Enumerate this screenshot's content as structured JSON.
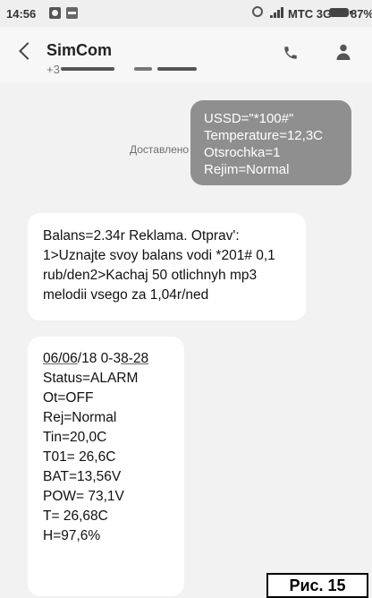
{
  "status_bar": {
    "time": "14:56",
    "carrier": "MTC 3G",
    "battery": "87%"
  },
  "header": {
    "contact_name": "SimCom",
    "contact_number_prefix": "+3"
  },
  "outgoing_message": {
    "status": "Доставлено",
    "lines": [
      "USSD=\"*100#\"",
      "Temperature=12,3C",
      "Otsrochka=1",
      "Rejim=Normal"
    ]
  },
  "incoming_1": {
    "lines": [
      "Balans=2.34r Reklama. Otprav':",
      "1>Uznajte svoy balans vodi *201# 0,1",
      "rub/den2>Kachaj 50 otlichnyh mp3",
      "melodii vsego za 1,04r/ned"
    ]
  },
  "incoming_2": {
    "date_day_month": "06/06",
    "date_year": "/18",
    "time_prefix": " 0-3",
    "time_suffix": "8-28",
    "lines": [
      "Status=ALARM",
      "Ot=OFF",
      "Rej=Normal",
      "Tin=20,0C",
      "T01= 26,6C",
      "BAT=13,56V",
      "POW= 73,1V",
      "T= 26,68C",
      "H=97,6%"
    ]
  },
  "figure_label": "Рис. 15",
  "colors": {
    "outgoing_bubble": "#8f8f8f",
    "incoming_bubble": "#ffffff",
    "background": "#f2f2f2"
  }
}
